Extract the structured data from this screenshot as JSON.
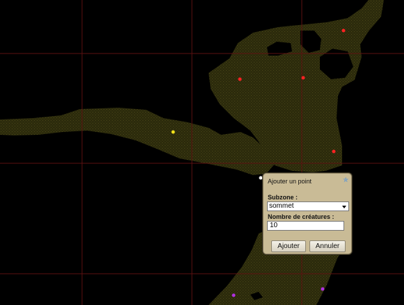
{
  "dialog": {
    "title": "Ajouter un point",
    "help_icon": "star-help-icon",
    "subzone_label": "Subzone :",
    "subzone_value": "sommet",
    "creatures_label": "Nombre de créatures :",
    "creatures_value": "10",
    "add_button": "Ajouter",
    "cancel_button": "Annuler"
  },
  "map": {
    "background_color": "#000000",
    "zone_color": "#2e2d0d",
    "grid_color": "#5c1010",
    "markers": [
      {
        "color": "#ff2222",
        "label": "red"
      },
      {
        "color": "#ff2222",
        "label": "red"
      },
      {
        "color": "#ff2222",
        "label": "red"
      },
      {
        "color": "#ff2222",
        "label": "red"
      },
      {
        "color": "#f2e21b",
        "label": "yellow"
      },
      {
        "color": "#ffffff",
        "label": "white"
      },
      {
        "color": "#b030e0",
        "label": "purple"
      },
      {
        "color": "#b030e0",
        "label": "purple"
      }
    ]
  }
}
